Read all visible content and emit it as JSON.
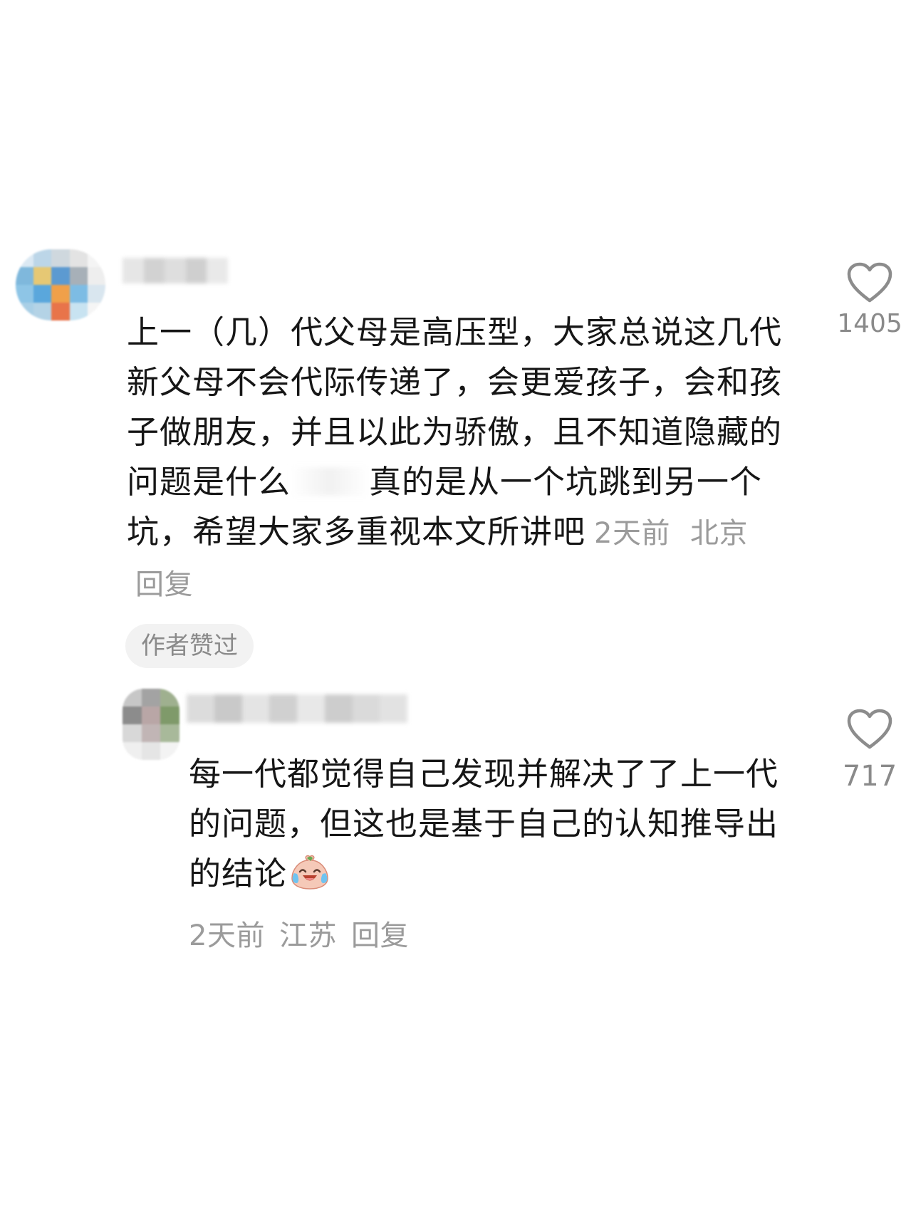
{
  "comments": [
    {
      "text_main": "上一（几）代父母是高压型，大家总说这几代新父母不会代际传递了，会更爱孩子，会和孩子做朋友，并且以此为骄傲，且不知道隐藏的问题是什么",
      "text_after_redact": "真的是从一个坑跳到另一个坑，希望大家多重视本文所讲吧",
      "time": "2天前",
      "location": "北京",
      "reply_label": "回复",
      "author_liked": "作者赞过",
      "like_count": "1405",
      "avatar_colors": [
        "#dbe9f3",
        "#bcd6e8",
        "#cfd8de",
        "#e3e3e3",
        "#f4f4f4",
        "#7fb8dc",
        "#e6c874",
        "#5c9ad1",
        "#a7b0b8",
        "#eeeeee",
        "#8ec5e6",
        "#5aa7dc",
        "#f0a04a",
        "#7dbce4",
        "#d9e6ef",
        "#a9cfe6",
        "#b4d3e6",
        "#e8744a",
        "#c8e3f1",
        "#f5f5f5"
      ],
      "username_colors": [
        "#e6e6e6",
        "#d2d2d2",
        "#dedede",
        "#cfcfcf",
        "#e9e9e9"
      ]
    }
  ],
  "reply": {
    "text": "每一代都觉得自己发现并解决了了上一代的问题，但这也是基于自己的认知推导出的结论",
    "emoji": "crying-laugh-emoji",
    "time": "2天前",
    "location": "江苏",
    "reply_label": "回复",
    "like_count": "717",
    "avatar_colors": [
      "#c7c7c7",
      "#a3a3a3",
      "#9fb08f",
      "#8c8c8c",
      "#b9a6a6",
      "#7f9a6a",
      "#d8d8d8",
      "#c1b5b5",
      "#a8b99a",
      "#efefef",
      "#e5e5e5",
      "#f3f3f3"
    ],
    "username_colors": [
      "#dcdcdc",
      "#c9c9c9",
      "#e4e4e4",
      "#d0d0d0",
      "#e8e8e8",
      "#cdcdcd",
      "#dadada",
      "#e2e2e2"
    ]
  },
  "colors": {
    "text": "#161616",
    "meta": "#9b9b9b",
    "pill_bg": "#f2f2f2",
    "heart_stroke": "#8c8c8c"
  },
  "icons": {
    "like": "heart-outline-icon"
  }
}
